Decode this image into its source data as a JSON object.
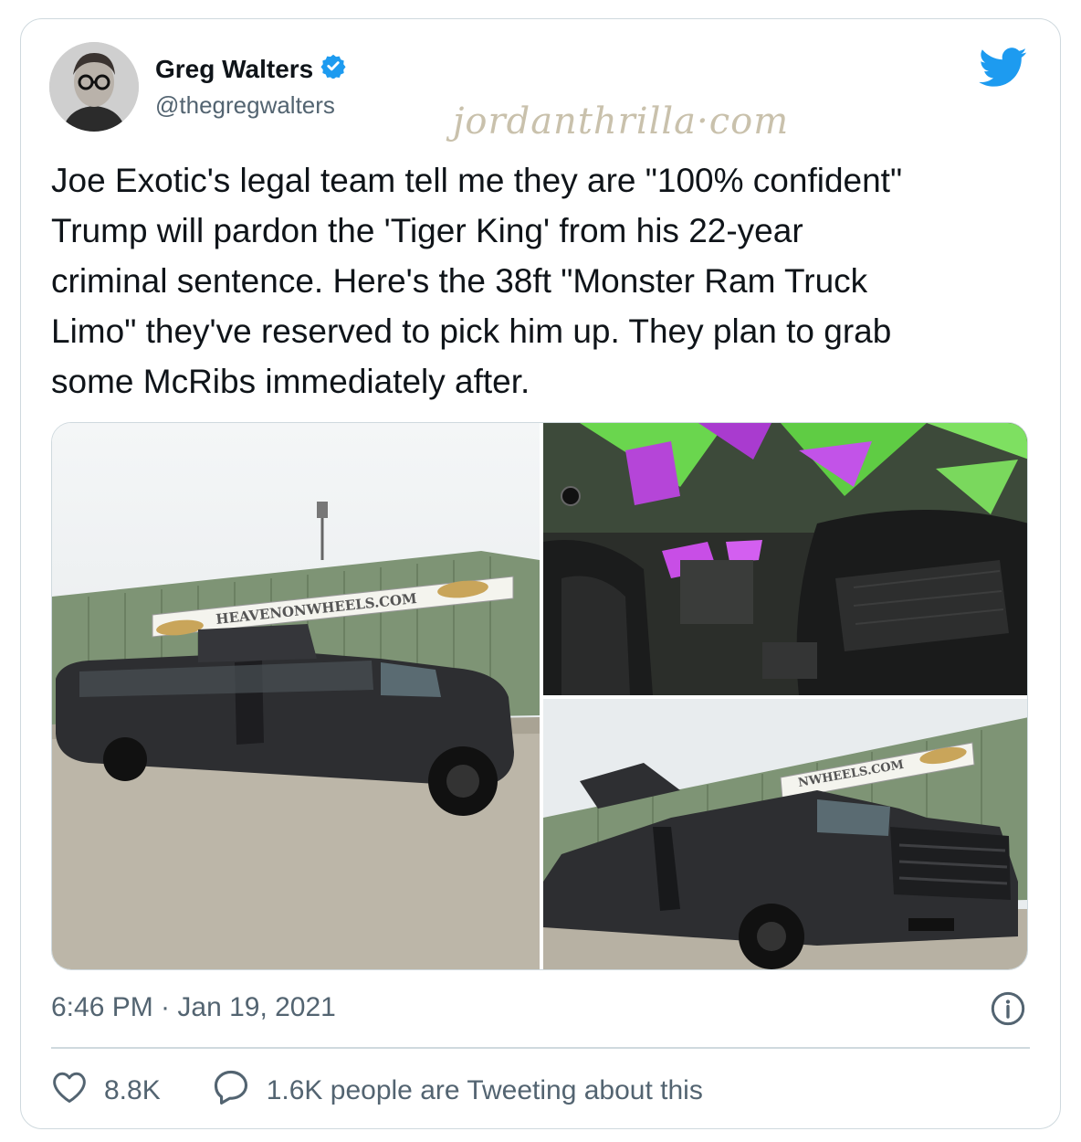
{
  "author": {
    "name": "Greg Walters",
    "handle": "@thegregwalters",
    "verified": true
  },
  "watermark": "jordanthrilla·com",
  "tweet": {
    "text": "Joe Exotic's legal team tell me they are \"100% confident\"\nTrump will pardon the 'Tiger King' from his 22-year\ncriminal sentence. Here's the 38ft \"Monster Ram Truck\nLimo\" they've reserved to pick him up. They plan to grab\nsome McRibs immediately after."
  },
  "media": {
    "sign_text_1": "HEAVENONWHEELS.COM",
    "sign_text_2": "NWHEELS.COM"
  },
  "meta": {
    "timestamp": "6:46 PM · Jan 19, 2021"
  },
  "actions": {
    "likes": "8.8K",
    "retweet_text": "1.6K people are Tweeting about this"
  },
  "colors": {
    "brand": "#1d9bf0",
    "text": "#0f1419",
    "secondary": "#536471",
    "border": "#cfd9de"
  }
}
